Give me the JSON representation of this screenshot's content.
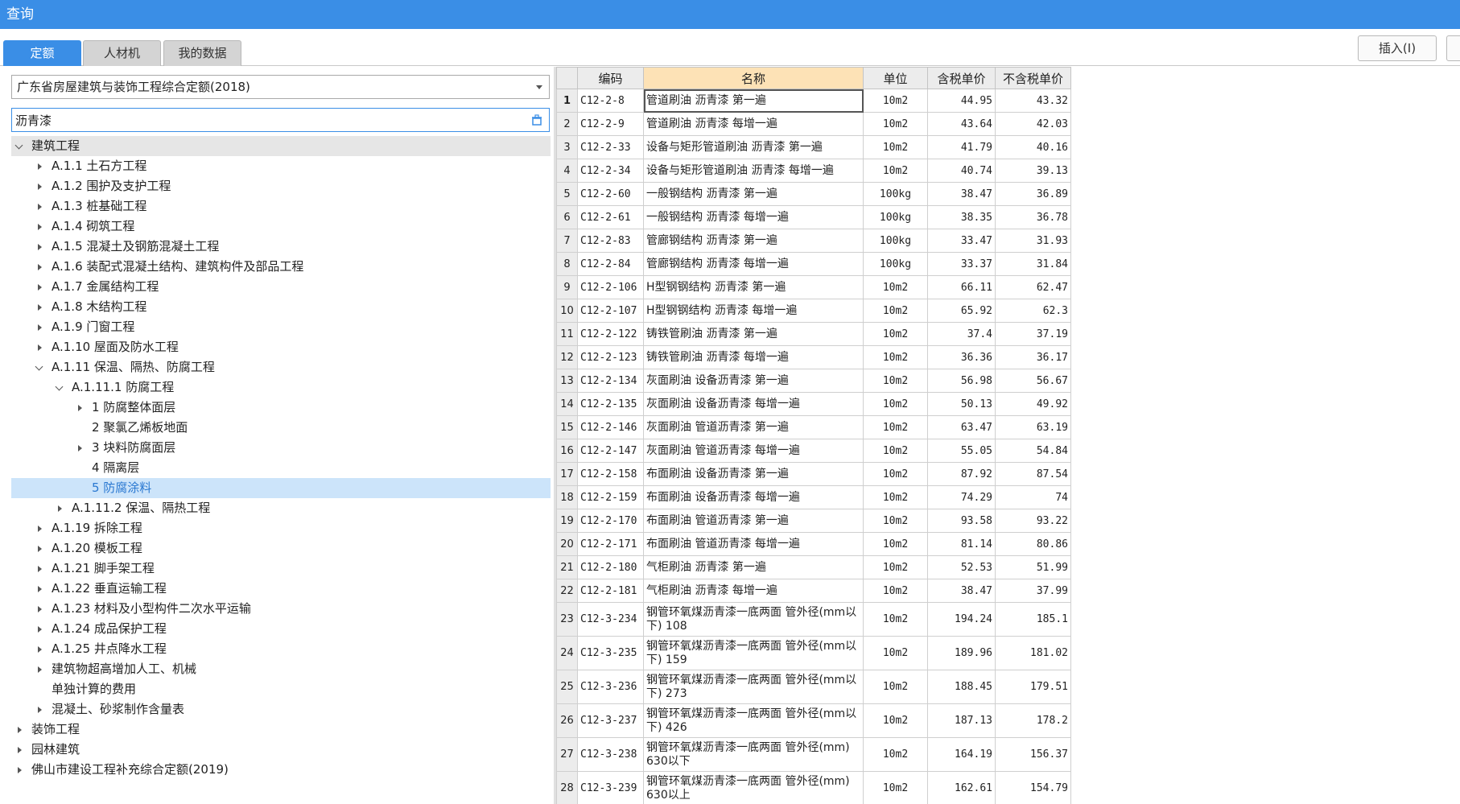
{
  "window": {
    "title": "查询"
  },
  "tabs": [
    {
      "label": "定额",
      "active": true
    },
    {
      "label": "人材机",
      "active": false
    },
    {
      "label": "我的数据",
      "active": false
    }
  ],
  "toolbar": {
    "insert_label": "插入(I)"
  },
  "quota_select": {
    "value": "广东省房屋建筑与装饰工程综合定额(2018)"
  },
  "search": {
    "value": "沥青漆"
  },
  "tree": [
    {
      "label": "建筑工程",
      "level": 0,
      "state": "open",
      "root": true
    },
    {
      "label": "A.1.1 土石方工程",
      "level": 1,
      "state": "closed"
    },
    {
      "label": "A.1.2 围护及支护工程",
      "level": 1,
      "state": "closed"
    },
    {
      "label": "A.1.3 桩基础工程",
      "level": 1,
      "state": "closed"
    },
    {
      "label": "A.1.4 砌筑工程",
      "level": 1,
      "state": "closed"
    },
    {
      "label": "A.1.5 混凝土及钢筋混凝土工程",
      "level": 1,
      "state": "closed"
    },
    {
      "label": "A.1.6 装配式混凝土结构、建筑构件及部品工程",
      "level": 1,
      "state": "closed"
    },
    {
      "label": "A.1.7 金属结构工程",
      "level": 1,
      "state": "closed"
    },
    {
      "label": "A.1.8 木结构工程",
      "level": 1,
      "state": "closed"
    },
    {
      "label": "A.1.9 门窗工程",
      "level": 1,
      "state": "closed"
    },
    {
      "label": "A.1.10 屋面及防水工程",
      "level": 1,
      "state": "closed"
    },
    {
      "label": "A.1.11 保温、隔热、防腐工程",
      "level": 1,
      "state": "open"
    },
    {
      "label": "A.1.11.1 防腐工程",
      "level": 2,
      "state": "open"
    },
    {
      "label": "1 防腐整体面层",
      "level": 3,
      "state": "closed"
    },
    {
      "label": "2 聚氯乙烯板地面",
      "level": 3,
      "state": "none"
    },
    {
      "label": "3 块料防腐面层",
      "level": 3,
      "state": "closed"
    },
    {
      "label": "4 隔离层",
      "level": 3,
      "state": "none"
    },
    {
      "label": "5 防腐涂料",
      "level": 3,
      "state": "none",
      "selected": true
    },
    {
      "label": "A.1.11.2 保温、隔热工程",
      "level": 2,
      "state": "closed"
    },
    {
      "label": "A.1.19 拆除工程",
      "level": 1,
      "state": "closed"
    },
    {
      "label": "A.1.20 模板工程",
      "level": 1,
      "state": "closed"
    },
    {
      "label": "A.1.21 脚手架工程",
      "level": 1,
      "state": "closed"
    },
    {
      "label": "A.1.22 垂直运输工程",
      "level": 1,
      "state": "closed"
    },
    {
      "label": "A.1.23 材料及小型构件二次水平运输",
      "level": 1,
      "state": "closed"
    },
    {
      "label": "A.1.24 成品保护工程",
      "level": 1,
      "state": "closed"
    },
    {
      "label": "A.1.25 井点降水工程",
      "level": 1,
      "state": "closed"
    },
    {
      "label": "建筑物超高增加人工、机械",
      "level": 1,
      "state": "closed"
    },
    {
      "label": "单独计算的费用",
      "level": 1,
      "state": "none"
    },
    {
      "label": "混凝土、砂浆制作含量表",
      "level": 1,
      "state": "closed"
    },
    {
      "label": "装饰工程",
      "level": 0,
      "state": "closed"
    },
    {
      "label": "园林建筑",
      "level": 0,
      "state": "closed"
    },
    {
      "label": "佛山市建设工程补充综合定额(2019)",
      "level": 0,
      "state": "closed"
    }
  ],
  "grid": {
    "headers": [
      "",
      "编码",
      "名称",
      "单位",
      "含税单价",
      "不含税单价"
    ],
    "rows": [
      {
        "n": "1",
        "code": "C12-2-8",
        "name": "管道刷油 沥青漆 第一遍",
        "unit": "10m2",
        "tax": "44.95",
        "notax": "43.32"
      },
      {
        "n": "2",
        "code": "C12-2-9",
        "name": "管道刷油 沥青漆 每增一遍",
        "unit": "10m2",
        "tax": "43.64",
        "notax": "42.03"
      },
      {
        "n": "3",
        "code": "C12-2-33",
        "name": "设备与矩形管道刷油 沥青漆 第一遍",
        "unit": "10m2",
        "tax": "41.79",
        "notax": "40.16"
      },
      {
        "n": "4",
        "code": "C12-2-34",
        "name": "设备与矩形管道刷油 沥青漆 每增一遍",
        "unit": "10m2",
        "tax": "40.74",
        "notax": "39.13"
      },
      {
        "n": "5",
        "code": "C12-2-60",
        "name": "一般钢结构 沥青漆 第一遍",
        "unit": "100kg",
        "tax": "38.47",
        "notax": "36.89"
      },
      {
        "n": "6",
        "code": "C12-2-61",
        "name": "一般钢结构 沥青漆 每增一遍",
        "unit": "100kg",
        "tax": "38.35",
        "notax": "36.78"
      },
      {
        "n": "7",
        "code": "C12-2-83",
        "name": "管廊钢结构 沥青漆 第一遍",
        "unit": "100kg",
        "tax": "33.47",
        "notax": "31.93"
      },
      {
        "n": "8",
        "code": "C12-2-84",
        "name": "管廊钢结构 沥青漆 每增一遍",
        "unit": "100kg",
        "tax": "33.37",
        "notax": "31.84"
      },
      {
        "n": "9",
        "code": "C12-2-106",
        "name": "H型钢钢结构 沥青漆 第一遍",
        "unit": "10m2",
        "tax": "66.11",
        "notax": "62.47"
      },
      {
        "n": "10",
        "code": "C12-2-107",
        "name": "H型钢钢结构 沥青漆 每增一遍",
        "unit": "10m2",
        "tax": "65.92",
        "notax": "62.3"
      },
      {
        "n": "11",
        "code": "C12-2-122",
        "name": "铸铁管刷油 沥青漆 第一遍",
        "unit": "10m2",
        "tax": "37.4",
        "notax": "37.19"
      },
      {
        "n": "12",
        "code": "C12-2-123",
        "name": "铸铁管刷油 沥青漆 每增一遍",
        "unit": "10m2",
        "tax": "36.36",
        "notax": "36.17"
      },
      {
        "n": "13",
        "code": "C12-2-134",
        "name": "灰面刷油 设备沥青漆 第一遍",
        "unit": "10m2",
        "tax": "56.98",
        "notax": "56.67"
      },
      {
        "n": "14",
        "code": "C12-2-135",
        "name": "灰面刷油 设备沥青漆 每增一遍",
        "unit": "10m2",
        "tax": "50.13",
        "notax": "49.92"
      },
      {
        "n": "15",
        "code": "C12-2-146",
        "name": "灰面刷油 管道沥青漆 第一遍",
        "unit": "10m2",
        "tax": "63.47",
        "notax": "63.19"
      },
      {
        "n": "16",
        "code": "C12-2-147",
        "name": "灰面刷油 管道沥青漆 每增一遍",
        "unit": "10m2",
        "tax": "55.05",
        "notax": "54.84"
      },
      {
        "n": "17",
        "code": "C12-2-158",
        "name": "布面刷油 设备沥青漆 第一遍",
        "unit": "10m2",
        "tax": "87.92",
        "notax": "87.54"
      },
      {
        "n": "18",
        "code": "C12-2-159",
        "name": "布面刷油 设备沥青漆 每增一遍",
        "unit": "10m2",
        "tax": "74.29",
        "notax": "74"
      },
      {
        "n": "19",
        "code": "C12-2-170",
        "name": "布面刷油 管道沥青漆 第一遍",
        "unit": "10m2",
        "tax": "93.58",
        "notax": "93.22"
      },
      {
        "n": "20",
        "code": "C12-2-171",
        "name": "布面刷油 管道沥青漆 每增一遍",
        "unit": "10m2",
        "tax": "81.14",
        "notax": "80.86"
      },
      {
        "n": "21",
        "code": "C12-2-180",
        "name": "气柜刷油 沥青漆 第一遍",
        "unit": "10m2",
        "tax": "52.53",
        "notax": "51.99"
      },
      {
        "n": "22",
        "code": "C12-2-181",
        "name": "气柜刷油 沥青漆 每增一遍",
        "unit": "10m2",
        "tax": "38.47",
        "notax": "37.99"
      },
      {
        "n": "23",
        "code": "C12-3-234",
        "name": "钢管环氧煤沥青漆一底两面 管外径(mm以下) 108",
        "unit": "10m2",
        "tax": "194.24",
        "notax": "185.1",
        "tall": true
      },
      {
        "n": "24",
        "code": "C12-3-235",
        "name": "钢管环氧煤沥青漆一底两面 管外径(mm以下) 159",
        "unit": "10m2",
        "tax": "189.96",
        "notax": "181.02",
        "tall": true
      },
      {
        "n": "25",
        "code": "C12-3-236",
        "name": "钢管环氧煤沥青漆一底两面 管外径(mm以下) 273",
        "unit": "10m2",
        "tax": "188.45",
        "notax": "179.51",
        "tall": true
      },
      {
        "n": "26",
        "code": "C12-3-237",
        "name": "钢管环氧煤沥青漆一底两面 管外径(mm以下) 426",
        "unit": "10m2",
        "tax": "187.13",
        "notax": "178.2",
        "tall": true
      },
      {
        "n": "27",
        "code": "C12-3-238",
        "name": "钢管环氧煤沥青漆一底两面 管外径(mm) 630以下",
        "unit": "10m2",
        "tax": "164.19",
        "notax": "156.37",
        "tall": true
      },
      {
        "n": "28",
        "code": "C12-3-239",
        "name": "钢管环氧煤沥青漆一底两面 管外径(mm) 630以上",
        "unit": "10m2",
        "tax": "162.61",
        "notax": "154.79",
        "tall": true
      }
    ]
  }
}
